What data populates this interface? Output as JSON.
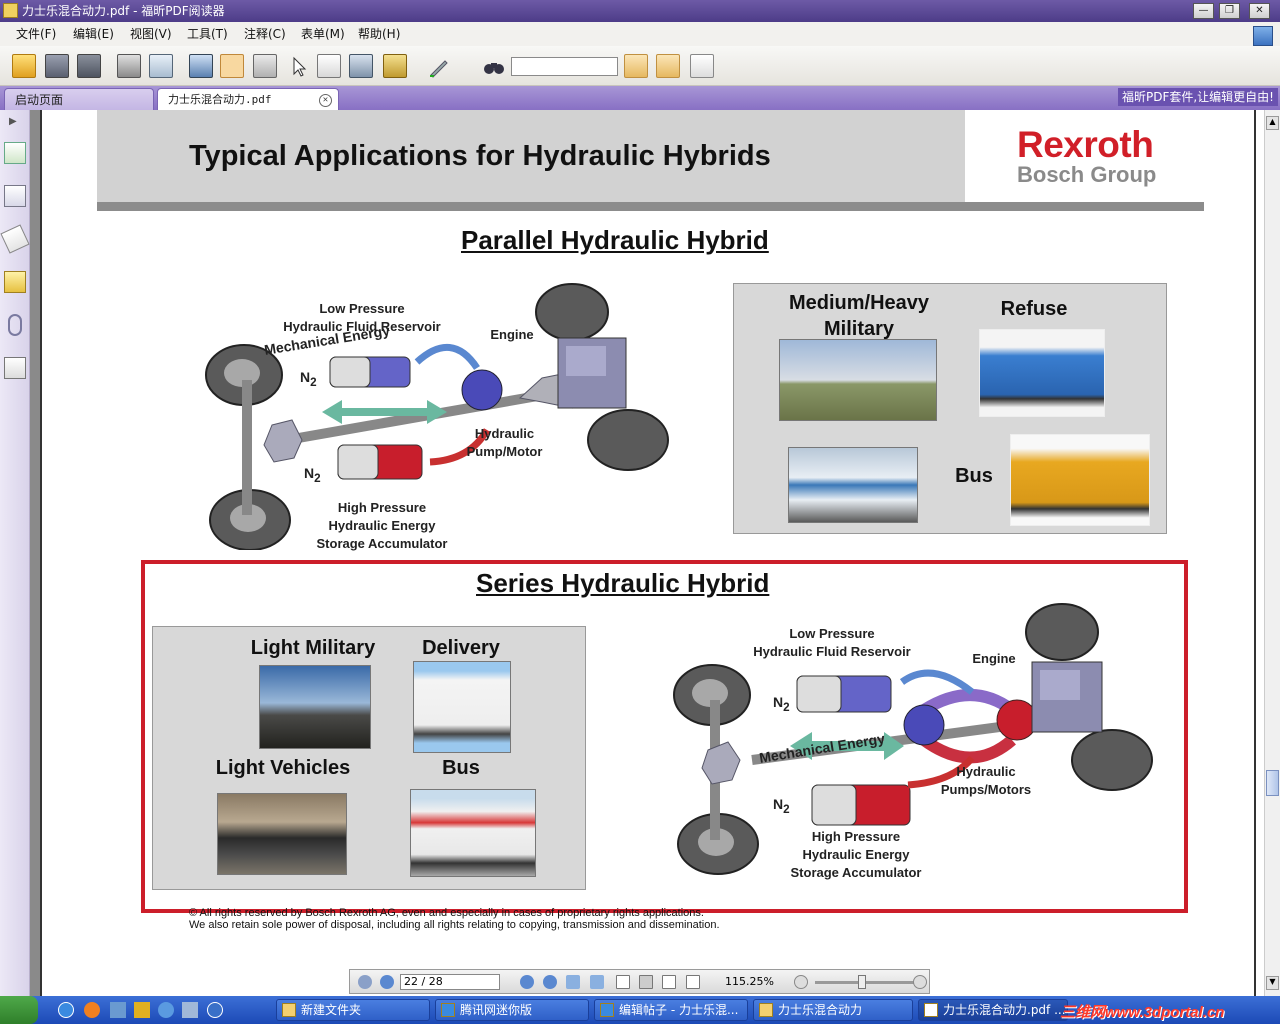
{
  "window": {
    "title": "力士乐混合动力.pdf - 福昕PDF阅读器"
  },
  "menu": [
    "文件(F)",
    "编辑(E)",
    "视图(V)",
    "工具(T)",
    "注释(C)",
    "表单(M)",
    "帮助(H)"
  ],
  "toolbar": {
    "find_placeholder": ""
  },
  "tabs": [
    {
      "label": "启动页面"
    },
    {
      "label": "力士乐混合动力.pdf"
    }
  ],
  "promo": "福昕PDF套件,让编辑更自由!",
  "slide": {
    "title": "Typical Applications for Hydraulic Hybrids",
    "brand": "Rexroth",
    "brand_sub": "Bosch Group",
    "parallel": {
      "heading": "Parallel Hydraulic Hybrid",
      "low_pressure": [
        "Low Pressure",
        "Hydraulic Fluid Reservoir"
      ],
      "engine": "Engine",
      "mechanical": "Mechanical Energy",
      "pump": [
        "Hydraulic",
        "Pump/Motor"
      ],
      "high_pressure": [
        "High Pressure",
        "Hydraulic Energy",
        "Storage Accumulator"
      ],
      "n2": "N",
      "sub": "2",
      "apps": {
        "medium_heavy": [
          "Medium/Heavy",
          "Military"
        ],
        "refuse": "Refuse",
        "bus": "Bus"
      }
    },
    "series": {
      "heading": "Series Hydraulic Hybrid",
      "apps": {
        "light_military": "Light Military",
        "delivery": "Delivery",
        "light_vehicles": "Light Vehicles",
        "bus": "Bus"
      },
      "low_pressure": [
        "Low Pressure",
        "Hydraulic Fluid Reservoir"
      ],
      "engine": "Engine",
      "mechanical": "Mechanical Energy",
      "pumps": [
        "Hydraulic",
        "Pumps/Motors"
      ],
      "high_pressure": [
        "High Pressure",
        "Hydraulic Energy",
        "Storage Accumulator"
      ]
    },
    "copyright": [
      "© All rights reserved by Bosch Rexroth AG, even and especially in cases of proprietary rights applications.",
      "We also retain sole power of disposal, including all rights relating to copying, transmission and dissemination."
    ]
  },
  "nav": {
    "page": "22 / 28",
    "zoom": "115.25%"
  },
  "taskbar": {
    "tasks": [
      "新建文件夹",
      "腾讯网迷你版",
      "编辑帖子 - 力士乐混...",
      "力士乐混合动力",
      "力士乐混合动力.pdf ..."
    ]
  },
  "watermark": "三维网www.3dportal.cn"
}
